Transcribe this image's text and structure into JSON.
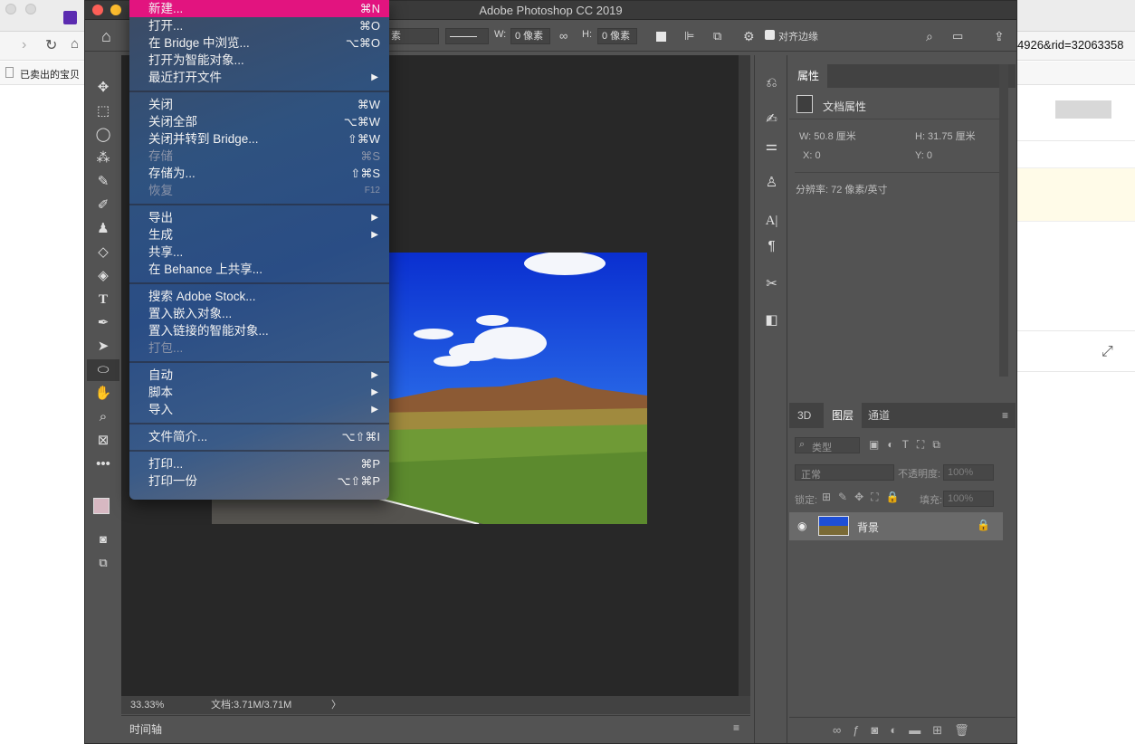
{
  "browser": {
    "url_tail": "4926&rid=32063358",
    "bookmark": "已卖出的宝贝"
  },
  "ps": {
    "title": "Adobe Photoshop CC 2019",
    "options": {
      "stroke_px": "素",
      "w_label": "W:",
      "w_value": "0 像素",
      "h_label": "H:",
      "h_value": "0 像素",
      "align_edges": "对齐边缘"
    },
    "status": {
      "zoom": "33.33%",
      "doc": "文档:3.71M/3.71M",
      "arrow": "〉"
    },
    "timeline_tab": "时间轴",
    "properties": {
      "tab": "属性",
      "section": "文档属性",
      "w": "W: 50.8 厘米",
      "h": "H: 31.75 厘米",
      "x": "X: 0",
      "y": "Y: 0",
      "resolution": "分辨率: 72 像素/英寸"
    },
    "layers": {
      "tabs": [
        "3D",
        "图层",
        "通道"
      ],
      "filter_kind": "类型",
      "blend_mode": "正常",
      "opacity_label": "不透明度:",
      "opacity_value": "100%",
      "lock_label": "锁定:",
      "fill_label": "填充:",
      "fill_value": "100%",
      "layer_name": "背景"
    }
  },
  "menu": {
    "groups": [
      [
        {
          "label": "新建...",
          "shortcut": "⌘N",
          "selected": true
        },
        {
          "label": "打开...",
          "shortcut": "⌘O"
        },
        {
          "label": "在 Bridge 中浏览...",
          "shortcut": "⌥⌘O"
        },
        {
          "label": "打开为智能对象...",
          "shortcut": ""
        },
        {
          "label": "最近打开文件",
          "shortcut": "",
          "submenu": true
        }
      ],
      [
        {
          "label": "关闭",
          "shortcut": "⌘W"
        },
        {
          "label": "关闭全部",
          "shortcut": "⌥⌘W"
        },
        {
          "label": "关闭并转到 Bridge...",
          "shortcut": "⇧⌘W"
        },
        {
          "label": "存储",
          "shortcut": "⌘S",
          "disabled": true
        },
        {
          "label": "存储为...",
          "shortcut": "⇧⌘S"
        },
        {
          "label": "恢复",
          "shortcut": "F12",
          "disabled": true
        }
      ],
      [
        {
          "label": "导出",
          "shortcut": "",
          "submenu": true
        },
        {
          "label": "生成",
          "shortcut": "",
          "submenu": true
        },
        {
          "label": "共享...",
          "shortcut": ""
        },
        {
          "label": "在 Behance 上共享...",
          "shortcut": ""
        }
      ],
      [
        {
          "label": "搜索 Adobe Stock...",
          "shortcut": ""
        },
        {
          "label": "置入嵌入对象...",
          "shortcut": ""
        },
        {
          "label": "置入链接的智能对象...",
          "shortcut": ""
        },
        {
          "label": "打包...",
          "shortcut": "",
          "disabled": true
        }
      ],
      [
        {
          "label": "自动",
          "shortcut": "",
          "submenu": true
        },
        {
          "label": "脚本",
          "shortcut": "",
          "submenu": true
        },
        {
          "label": "导入",
          "shortcut": "",
          "submenu": true
        }
      ],
      [
        {
          "label": "文件简介...",
          "shortcut": "⌥⇧⌘I"
        }
      ],
      [
        {
          "label": "打印...",
          "shortcut": "⌘P"
        },
        {
          "label": "打印一份",
          "shortcut": "⌥⇧⌘P"
        }
      ]
    ]
  },
  "colors": {
    "menu_highlight": "#e2147f",
    "ps_panel": "#535353",
    "ps_canvas": "#282828"
  }
}
